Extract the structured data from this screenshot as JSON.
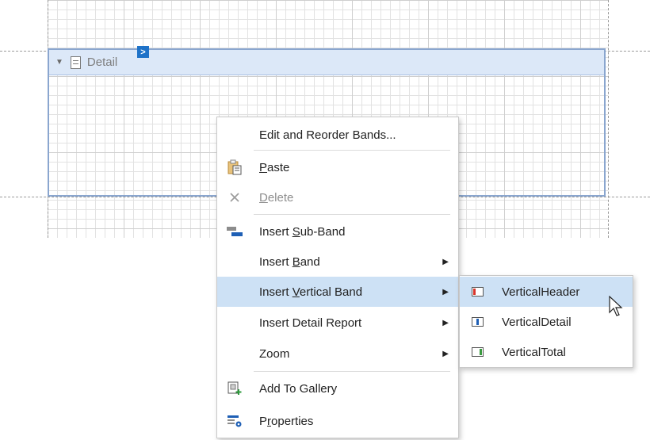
{
  "band": {
    "caption": "Detail",
    "smart_tag": ">"
  },
  "context_menu": {
    "items": [
      {
        "label": "Edit and Reorder Bands...",
        "icon": "none"
      },
      {
        "label": "Paste",
        "icon": "paste-icon",
        "mnemonic": "P"
      },
      {
        "label": "Delete",
        "icon": "delete-icon",
        "mnemonic": "D",
        "disabled": true
      },
      {
        "label": "Insert Sub-Band",
        "icon": "insert-sub-band-icon",
        "mnemonic": "S"
      },
      {
        "label": "Insert Band",
        "icon": "none",
        "mnemonic": "B",
        "submenu": true
      },
      {
        "label": "Insert Vertical Band",
        "icon": "none",
        "mnemonic": "V",
        "submenu": true,
        "highlighted": true
      },
      {
        "label": "Insert Detail Report",
        "icon": "none",
        "submenu": true
      },
      {
        "label": "Zoom",
        "icon": "none",
        "submenu": true
      },
      {
        "label": "Add To Gallery",
        "icon": "add-to-gallery-icon"
      },
      {
        "label": "Properties",
        "icon": "properties-icon",
        "mnemonic": "r"
      }
    ]
  },
  "submenu": {
    "items": [
      {
        "label": "VerticalHeader",
        "icon": "vertical-header-icon",
        "highlighted": true
      },
      {
        "label": "VerticalDetail",
        "icon": "vertical-detail-icon"
      },
      {
        "label": "VerticalTotal",
        "icon": "vertical-total-icon"
      }
    ]
  },
  "colors": {
    "highlight": "#cde1f5",
    "band_caption": "#dce8f8",
    "band_border": "#8aa6cf",
    "smart_tag": "#1e72c8"
  }
}
